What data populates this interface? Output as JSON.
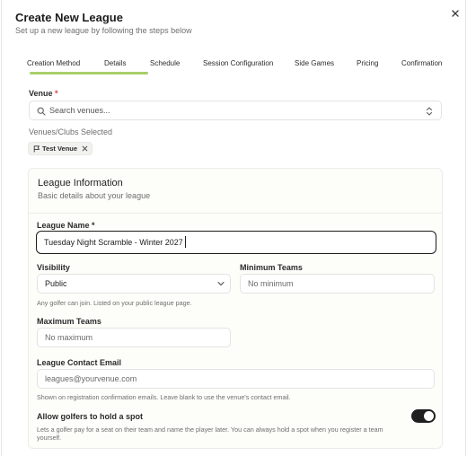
{
  "header": {
    "title": "Create New League",
    "subtitle": "Set up a new league by following the steps below"
  },
  "steps": [
    {
      "label": "Creation Method"
    },
    {
      "label": "Details"
    },
    {
      "label": "Schedule"
    },
    {
      "label": "Session Configuration"
    },
    {
      "label": "Side Games"
    },
    {
      "label": "Pricing"
    },
    {
      "label": "Confirmation"
    }
  ],
  "venue": {
    "label": "Venue",
    "required_mark": "*",
    "search_placeholder": "Search venues...",
    "selected_label": "Venues/Clubs Selected",
    "selected": [
      {
        "name": "Test Venue"
      }
    ]
  },
  "league_info": {
    "title": "League Information",
    "subtitle": "Basic details about your league",
    "name_label": "League Name *",
    "name_value": "Tuesday Night Scramble - Winter 2027",
    "visibility_label": "Visibility",
    "visibility_value": "Public",
    "visibility_hint": "Any golfer can join. Listed on your public league page.",
    "min_teams_label": "Minimum Teams",
    "min_teams_placeholder": "No minimum",
    "max_teams_label": "Maximum Teams",
    "max_teams_placeholder": "No maximum",
    "contact_label": "League Contact Email",
    "contact_placeholder": "leagues@yourvenue.com",
    "contact_hint": "Shown on registration confirmation emails. Leave blank to use the venue's contact email.",
    "hold_label": "Allow golfers to hold a spot",
    "hold_desc_1": "Lets a golfer pay for a seat on their team and name the player later. You can always hold a spot when you register a team",
    "hold_desc_2": "yourself.",
    "hold_enabled": true
  },
  "colors": {
    "accent_track": "#a9cf6b",
    "required": "#d93b3b",
    "toggle_on": "#1f1f1f"
  }
}
